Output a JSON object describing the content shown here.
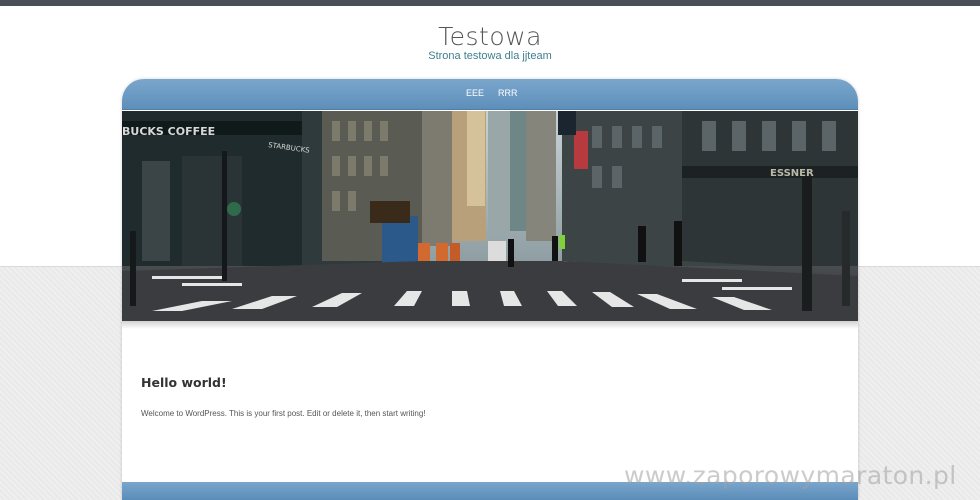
{
  "site": {
    "title": "Testowa",
    "description": "Strona testowa dla jjteam"
  },
  "nav": {
    "items": [
      {
        "label": "EEE"
      },
      {
        "label": "RRR"
      }
    ]
  },
  "hero": {
    "storefront_sign": "BUCKS COFFEE",
    "shop_sign": "STARBUCKS",
    "right_sign": "ESSNER"
  },
  "post": {
    "title": "Hello world!",
    "body": "Welcome to WordPress. This is your first post. Edit or delete it, then start writing!"
  },
  "watermark": "www.zaporowymaraton.pl",
  "colors": {
    "nav_blue": "#6b9ac4",
    "description_teal": "#3f7f8e",
    "top_bar": "#4a4f57"
  }
}
